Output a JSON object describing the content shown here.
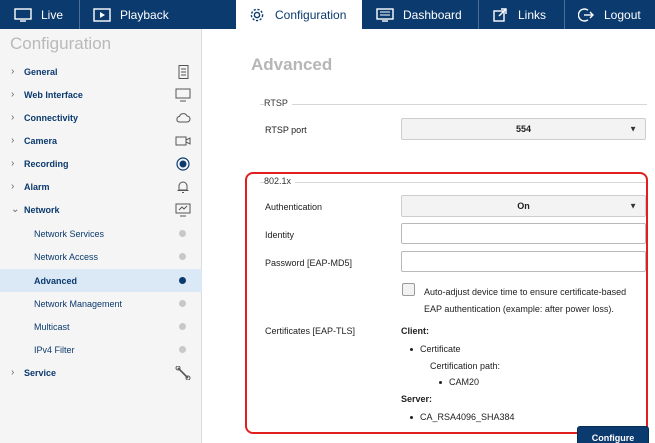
{
  "nav": {
    "live": "Live",
    "playback": "Playback",
    "configuration": "Configuration",
    "dashboard": "Dashboard",
    "links": "Links",
    "logout": "Logout"
  },
  "sidebar": {
    "title": "Configuration",
    "items": [
      {
        "label": "General",
        "icon": "document-icon"
      },
      {
        "label": "Web Interface",
        "icon": "monitor-icon"
      },
      {
        "label": "Connectivity",
        "icon": "cloud-icon"
      },
      {
        "label": "Camera",
        "icon": "camera-icon"
      },
      {
        "label": "Recording",
        "icon": "record-icon"
      },
      {
        "label": "Alarm",
        "icon": "bell-icon"
      },
      {
        "label": "Network",
        "icon": "network-icon"
      },
      {
        "label": "Service",
        "icon": "wrench-icon"
      }
    ],
    "network_sub": [
      {
        "label": "Network Services"
      },
      {
        "label": "Network Access"
      },
      {
        "label": "Advanced"
      },
      {
        "label": "Network Management"
      },
      {
        "label": "Multicast"
      },
      {
        "label": "IPv4 Filter"
      }
    ]
  },
  "main": {
    "title": "Advanced",
    "rtsp": {
      "section": "RTSP",
      "port_label": "RTSP port",
      "port_value": "554"
    },
    "dot1x": {
      "section": "802.1x",
      "auth_label": "Authentication",
      "auth_value": "On",
      "identity_label": "Identity",
      "identity_value": "",
      "password_label": "Password [EAP-MD5]",
      "password_value": "",
      "autoadjust_text": "Auto-adjust device time to ensure certificate-based EAP authentication (example: after power loss).",
      "certs_label": "Certificates [EAP-TLS]",
      "client_label": "Client:",
      "client_cert": "Certificate",
      "cert_path_label": "Certification path:",
      "cert_path_value": "CAM20",
      "server_label": "Server:",
      "server_cert": "CA_RSA4096_SHA384"
    },
    "configure_button": "Configure"
  },
  "colors": {
    "topbar": "#0b3a6e",
    "accent": "#0b3a6e",
    "highlight_box": "#e02020",
    "active_sidebar_bg": "#dbe9f6"
  }
}
